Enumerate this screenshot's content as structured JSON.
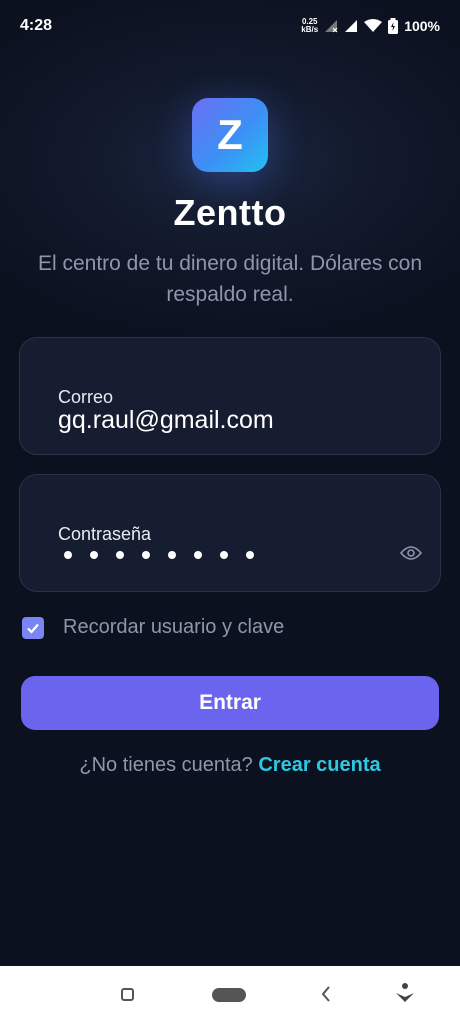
{
  "status_bar": {
    "time": "4:28",
    "net_speed_value": "0.25",
    "net_speed_unit": "kB/s",
    "battery": "100%"
  },
  "brand": {
    "logo_letter": "Z",
    "title": "Zentto",
    "tagline": "El centro de tu dinero digital. Dólares con respaldo real."
  },
  "form": {
    "email": {
      "label": "Correo",
      "value": "gq.raul@gmail.com"
    },
    "password": {
      "label": "Contraseña",
      "masked_length": 8
    },
    "remember": {
      "label": "Recordar usuario y clave",
      "checked": true
    },
    "submit_label": "Entrar"
  },
  "signup": {
    "prompt": "¿No tienes cuenta?",
    "link": "Crear cuenta"
  },
  "colors": {
    "accent": "#6a64ee",
    "link": "#2ec8e0",
    "background": "#0d1220"
  }
}
